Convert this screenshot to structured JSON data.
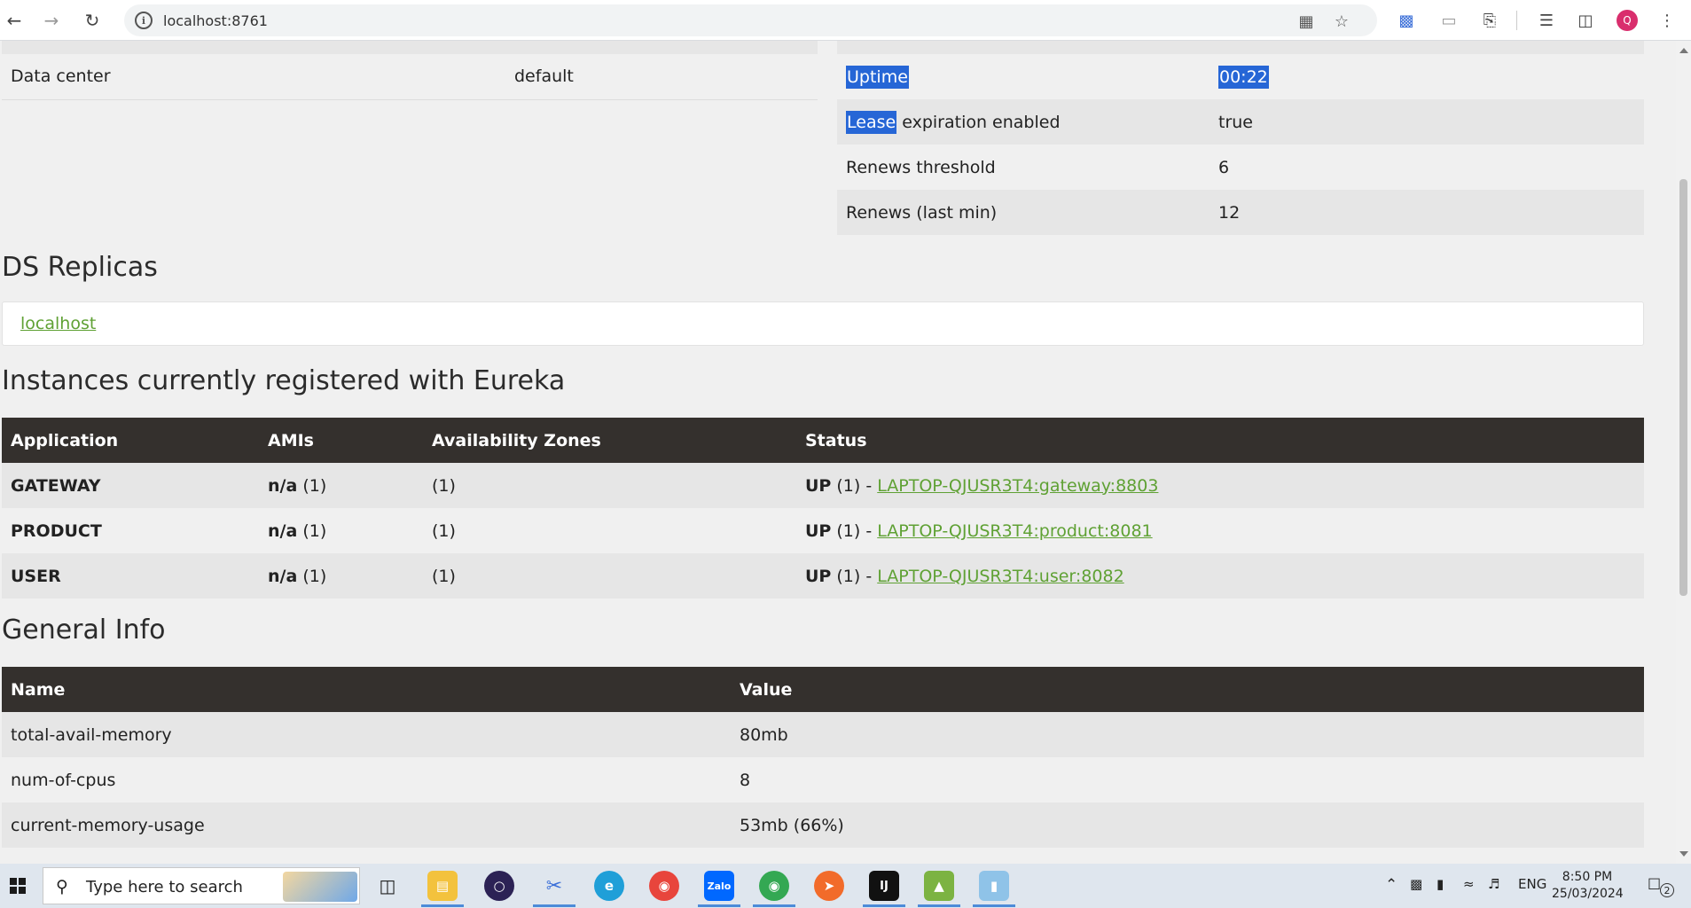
{
  "browser": {
    "url": "localhost:8761",
    "profile_initial": "Q"
  },
  "status_table": {
    "left": [
      {
        "label": "Data center",
        "value": "default"
      }
    ],
    "right": [
      {
        "label_hl": "Uptime",
        "label_rest": "",
        "value": "00:22",
        "value_highlighted": true
      },
      {
        "label_hl": "Lease",
        "label_rest": " expiration enabled",
        "value": "true",
        "value_highlighted": false
      },
      {
        "label_hl": "",
        "label_rest": "Renews threshold",
        "value": "6",
        "value_highlighted": false
      },
      {
        "label_hl": "",
        "label_rest": "Renews (last min)",
        "value": "12",
        "value_highlighted": false
      }
    ]
  },
  "ds_replicas": {
    "title": "DS Replicas",
    "items": [
      "localhost"
    ]
  },
  "instances": {
    "title": "Instances currently registered with Eureka",
    "headers": [
      "Application",
      "AMIs",
      "Availability Zones",
      "Status"
    ],
    "rows": [
      {
        "application": "GATEWAY",
        "ami_strong": "n/a",
        "ami_count": " (1)",
        "zones": "(1)",
        "status_strong": "UP",
        "status_count": " (1) - ",
        "link": "LAPTOP-QJUSR3T4:gateway:8803"
      },
      {
        "application": "PRODUCT",
        "ami_strong": "n/a",
        "ami_count": " (1)",
        "zones": "(1)",
        "status_strong": "UP",
        "status_count": " (1) - ",
        "link": "LAPTOP-QJUSR3T4:product:8081"
      },
      {
        "application": "USER",
        "ami_strong": "n/a",
        "ami_count": " (1)",
        "zones": "(1)",
        "status_strong": "UP",
        "status_count": " (1) - ",
        "link": "LAPTOP-QJUSR3T4:user:8082"
      }
    ]
  },
  "general_info": {
    "title": "General Info",
    "headers": [
      "Name",
      "Value"
    ],
    "rows": [
      {
        "name": "total-avail-memory",
        "value": "80mb"
      },
      {
        "name": "num-of-cpus",
        "value": "8"
      },
      {
        "name": "current-memory-usage",
        "value": "53mb (66%)"
      }
    ]
  },
  "taskbar": {
    "search_placeholder": "Type here to search",
    "language": "ENG",
    "time": "8:50 PM",
    "date": "25/03/2024",
    "notification_count": "2",
    "zalo_label": "Zalo"
  },
  "colors": {
    "link_green": "#5fa134",
    "table_header": "#34302d",
    "selection_blue": "#2666d6"
  }
}
